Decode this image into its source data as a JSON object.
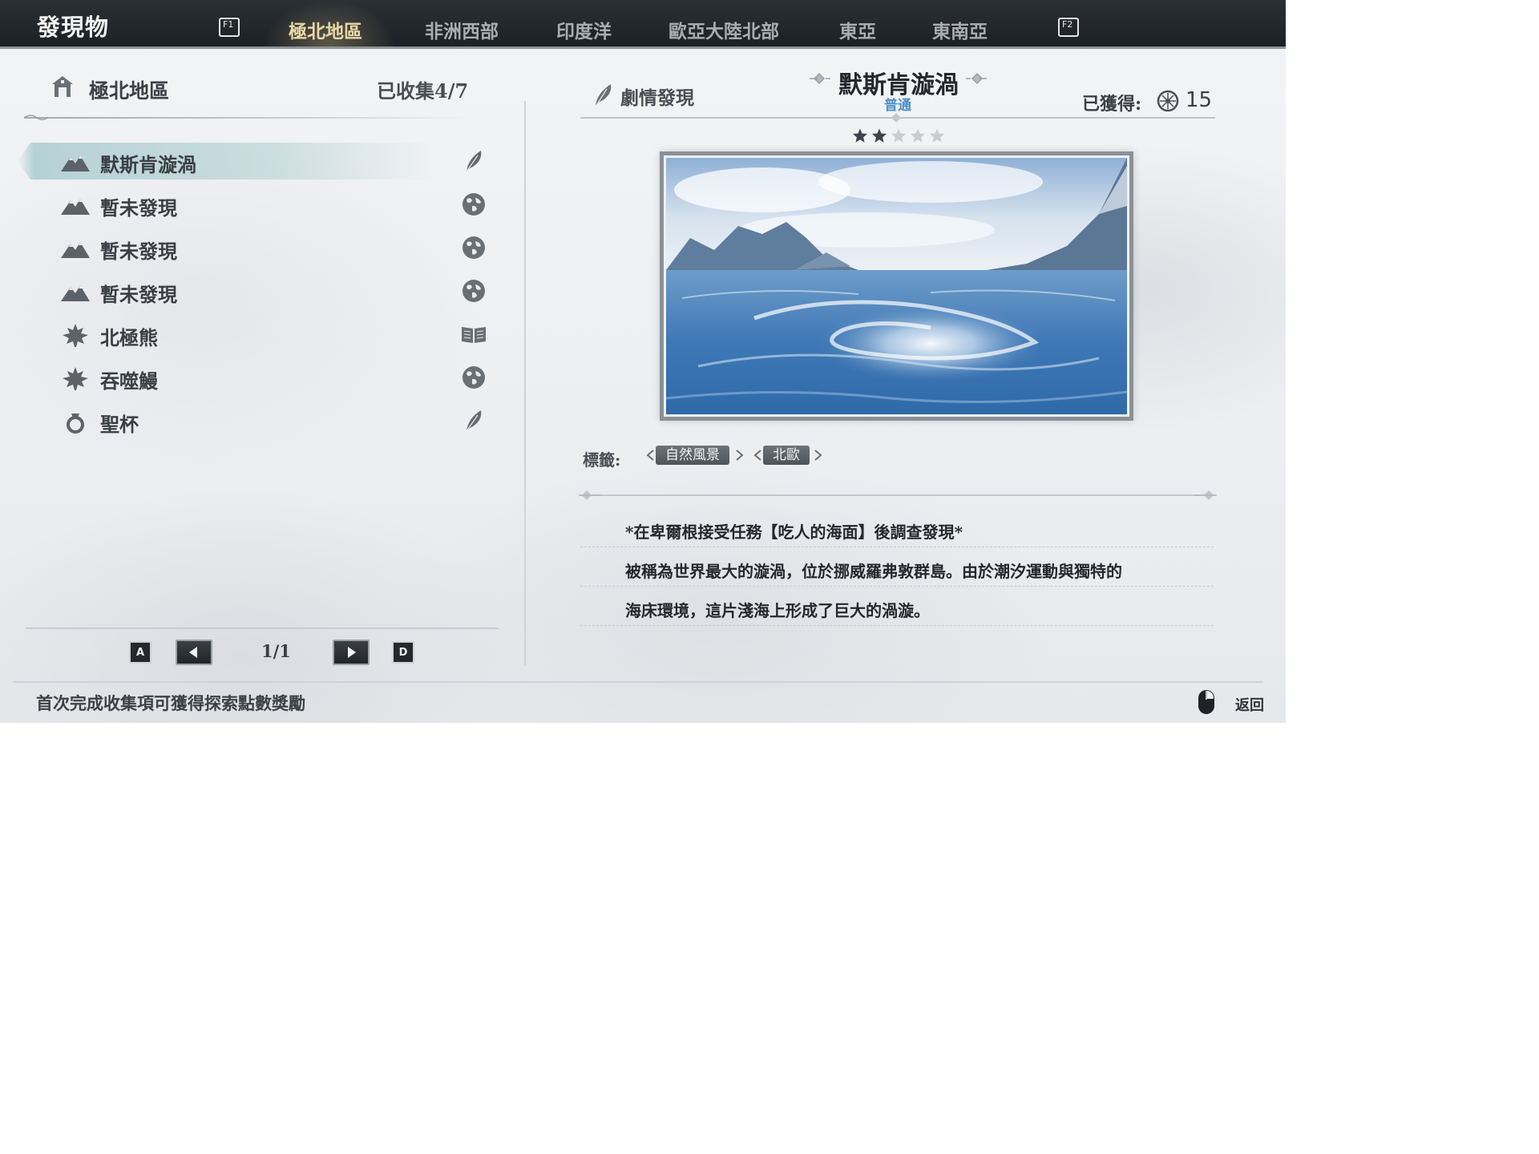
{
  "app": {
    "title": "發現物"
  },
  "tabs": {
    "left_key": "F1",
    "right_key": "F2",
    "items": [
      {
        "label": "極北地區",
        "active": true
      },
      {
        "label": "非洲西部",
        "active": false
      },
      {
        "label": "印度洋",
        "active": false
      },
      {
        "label": "歐亞大陸北部",
        "active": false
      },
      {
        "label": "東亞",
        "active": false
      },
      {
        "label": "東南亞",
        "active": false
      }
    ]
  },
  "left_panel": {
    "region_title": "極北地區",
    "collected": "已收集4/7",
    "items": [
      {
        "label": "默斯肯漩渦",
        "icon": "mountain-icon",
        "type_icon": "feather-icon",
        "selected": true
      },
      {
        "label": "暫未發現",
        "icon": "mountain-icon",
        "type_icon": "globe-icon",
        "selected": false
      },
      {
        "label": "暫未發現",
        "icon": "mountain-icon",
        "type_icon": "globe-icon",
        "selected": false
      },
      {
        "label": "暫未發現",
        "icon": "mountain-icon",
        "type_icon": "globe-icon",
        "selected": false
      },
      {
        "label": "北極熊",
        "icon": "leaf-icon",
        "type_icon": "book-icon",
        "selected": false
      },
      {
        "label": "吞噬鰻",
        "icon": "leaf-icon",
        "type_icon": "globe-icon",
        "selected": false
      },
      {
        "label": "聖杯",
        "icon": "ring-icon",
        "type_icon": "feather-icon",
        "selected": false
      }
    ],
    "pager": {
      "prev_key": "A",
      "next_key": "D",
      "page": "1/1"
    }
  },
  "detail": {
    "category": "劇情發現",
    "title": "默斯肯漩渦",
    "rarity": "普通",
    "rarity_color": "#4a8fc9",
    "obtained_label": "已獲得:",
    "obtained_value": "15",
    "stars_filled": 2,
    "stars_total": 5,
    "tags_label": "標籤:",
    "tags": [
      "自然風景",
      "北歐"
    ],
    "description": [
      "*在卑爾根接受任務【吃人的海面】後調查發現*",
      "被稱為世界最大的漩渦，位於挪威羅弗敦群島。由於潮汐運動與獨特的",
      "海床環境，這片淺海上形成了巨大的渦漩。"
    ]
  },
  "footer": {
    "hint": "首次完成收集項可獲得探索點數獎勵",
    "back_label": "返回"
  }
}
